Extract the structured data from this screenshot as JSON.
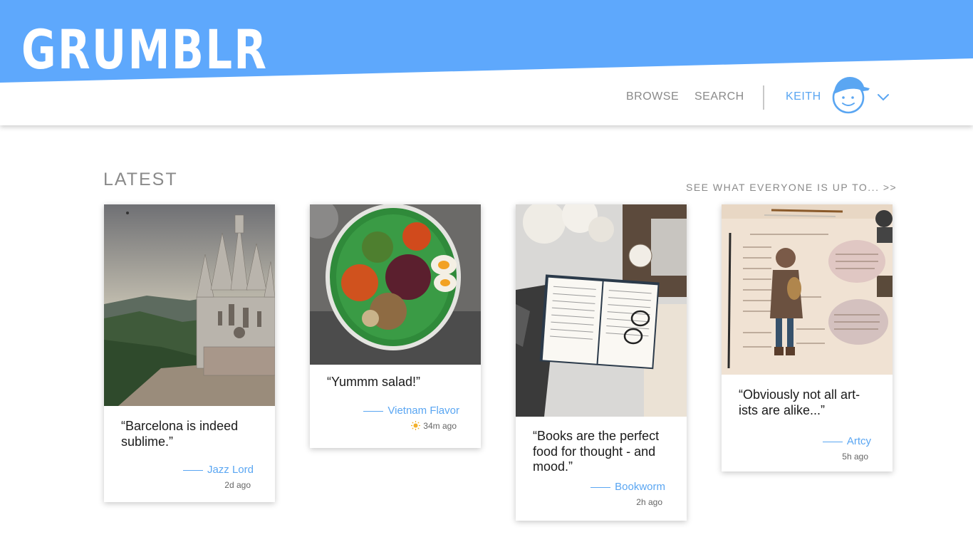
{
  "app": {
    "logo": "GRUMBLR",
    "brand_color": "#5ea8fc",
    "accent_color": "#5aa6f2"
  },
  "nav": {
    "browse": "BROWSE",
    "search": "SEARCH",
    "user_name": "KEITH",
    "avatar_icon": "cartoon-boy-with-cap-icon",
    "menu_icon": "chevron-down-icon"
  },
  "section": {
    "title": "LATEST",
    "see_all": "SEE WHAT EVERYONE IS UP TO...  >>"
  },
  "posts": [
    {
      "image": "barcelona-cathedral-photo",
      "quote": "“Barcelona is indeed sublime.”",
      "author": "Jazz Lord",
      "time": "2d ago"
    },
    {
      "image": "rice-salad-plate-photo",
      "quote": "“Yummm salad!”",
      "author": "Vietnam Flavor",
      "time": "34m ago",
      "time_icon": "sun-icon"
    },
    {
      "image": "open-book-and-glasses-photo",
      "quote": "“Books are the perfect food for thought - and mood.”",
      "author": "Bookworm",
      "time": "2h ago"
    },
    {
      "image": "illustrated-sketchbook-page-photo",
      "quote": "“Obviously not all art-ists are alike...”",
      "author": "Artcy",
      "time": "5h ago"
    }
  ]
}
